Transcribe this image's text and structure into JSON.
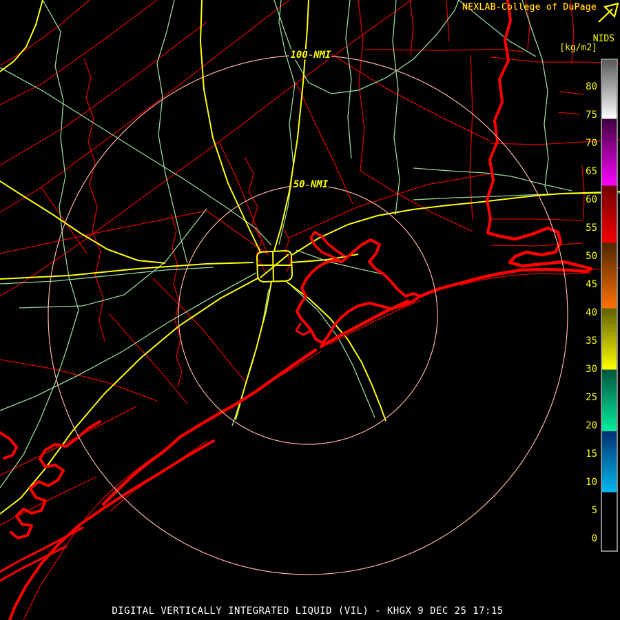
{
  "header": {
    "brand": "NEXLAB-College of DuPage"
  },
  "scale": {
    "product": "NIDS",
    "units": "[kg/m2]",
    "ticks": [
      "80",
      "75",
      "70",
      "65",
      "60",
      "55",
      "50",
      "45",
      "40",
      "35",
      "30",
      "25",
      "20",
      "15",
      "10",
      "5",
      "0"
    ],
    "segment_colors": {
      "white_high": "#ffffff",
      "magenta": "#ff00ff",
      "red": "#f40000",
      "orange": "#ff7000",
      "yellow": "#ffff00",
      "teal": "#00efa0",
      "blue": "#00b8f0",
      "black_low": "#000000"
    }
  },
  "map": {
    "ring_label_outer": "100 NMI",
    "ring_label_inner": "50 NMI",
    "colors": {
      "county_lines": "#d80000",
      "coastline": "#ff0000",
      "highways": "#98d898",
      "interstates": "#ffff00",
      "range_rings": "#ffb2a0",
      "labels": "#ffff00",
      "background": "#000000"
    }
  },
  "footer": {
    "caption": "DIGITAL VERTICALLY INTEGRATED LIQUID (VIL) - KHGX 9 DEC 25 17:15"
  }
}
